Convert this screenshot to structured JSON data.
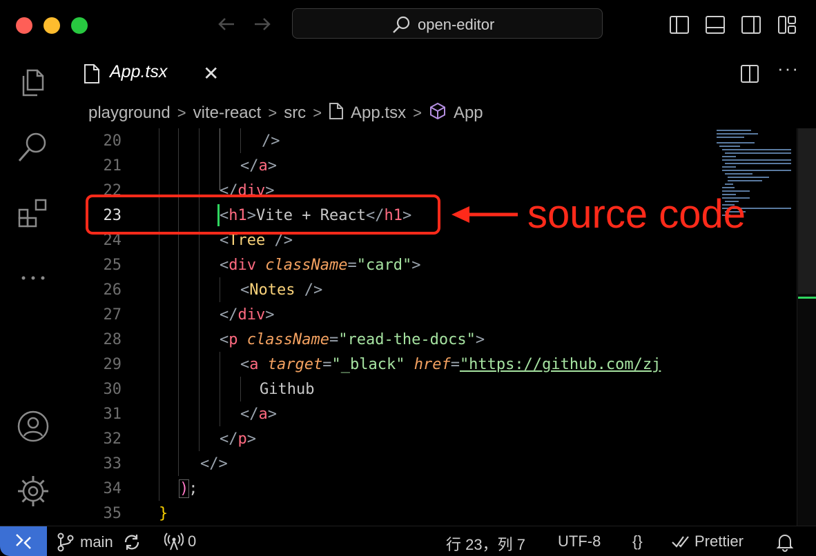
{
  "titlebar": {
    "command_center_text": "open-editor"
  },
  "tab": {
    "label": "App.tsx",
    "close_glyph": "✕",
    "more_glyph": "···"
  },
  "breadcrumb": {
    "items": [
      "playground",
      "vite-react",
      "src",
      "App.tsx",
      "App"
    ],
    "separator": ">"
  },
  "editor": {
    "lines": [
      {
        "n": "20"
      },
      {
        "n": "21"
      },
      {
        "n": "22"
      },
      {
        "n": "23"
      },
      {
        "n": "24"
      },
      {
        "n": "25"
      },
      {
        "n": "26"
      },
      {
        "n": "27"
      },
      {
        "n": "28"
      },
      {
        "n": "29"
      },
      {
        "n": "30"
      },
      {
        "n": "31"
      },
      {
        "n": "32"
      },
      {
        "n": "33"
      },
      {
        "n": "34"
      },
      {
        "n": "35"
      }
    ],
    "code": {
      "l20": "/>",
      "l21_tag": "a",
      "l22_tag": "div",
      "l23_tag": "h1",
      "l23_text": "Vite + React",
      "l24_comp": "Tree",
      "l25_tag": "div",
      "l25_attr": "className",
      "l25_val": "\"card\"",
      "l26_comp": "Notes",
      "l27_tag": "div",
      "l28_tag": "p",
      "l28_attr": "className",
      "l28_val": "\"read-the-docs\"",
      "l29_tag": "a",
      "l29_attr1": "target",
      "l29_val1": "\"_black\"",
      "l29_attr2": "href",
      "l29_val2": "\"https://github.com/zj",
      "l30_text": "Github",
      "l31_tag": "a",
      "l32_tag": "p",
      "l33_text": "</>",
      "l34_paren": ")",
      "l34_semi": ";",
      "l35_brace": "}"
    }
  },
  "annotation": {
    "label": "source code",
    "color": "#ff2a1a"
  },
  "statusbar": {
    "branch": "main",
    "ports": "0",
    "position": "行 23，列 7",
    "encoding": "UTF-8",
    "language_glyph": "{}",
    "formatter": "Prettier"
  },
  "colors": {
    "accent": "#3b6fd4",
    "cursor": "#2fd65f",
    "tag": "#ff6b81",
    "string": "#a6e3a1",
    "attribute": "#f4a261"
  }
}
